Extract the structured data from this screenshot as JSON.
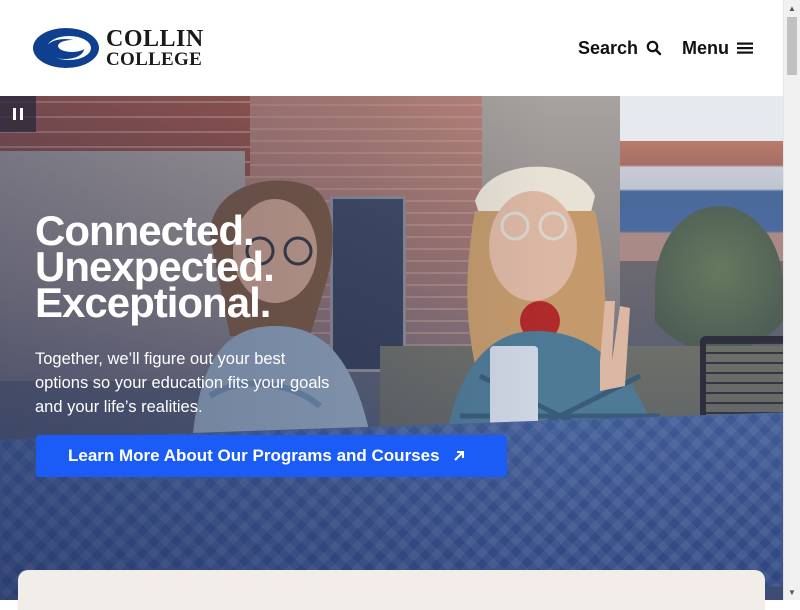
{
  "header": {
    "logo": {
      "line1": "COLLIN",
      "line2": "COLLEGE",
      "icon": "collin-swoosh-logo"
    },
    "search_label": "Search",
    "search_icon": "search-icon",
    "menu_label": "Menu",
    "menu_icon": "hamburger-icon"
  },
  "hero": {
    "pause_icon": "pause-icon",
    "headline": [
      "Connected.",
      "Unexpected.",
      "Exceptional."
    ],
    "subtext": "Together, we’ll figure out your best options so your education fits your goals and your life’s realities.",
    "cta_label": "Learn More About Our Programs and Courses",
    "cta_icon": "arrow-up-right-icon"
  },
  "colors": {
    "brand_blue": "#1a5cf5",
    "logo_navy": "#0f3f8f",
    "card_bg": "#f1eeea"
  },
  "scrollbar": {
    "up_icon": "scroll-up-arrow-icon",
    "down_icon": "scroll-down-arrow-icon"
  }
}
